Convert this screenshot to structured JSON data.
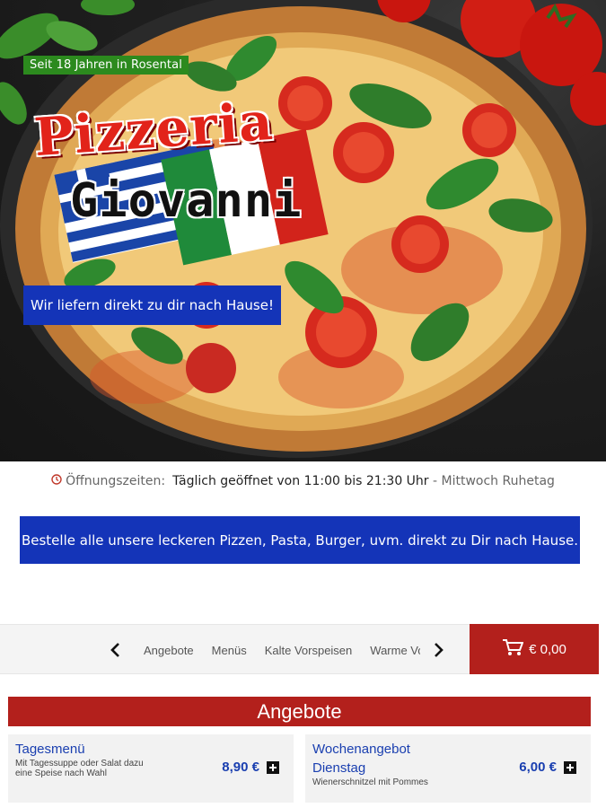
{
  "hero": {
    "since_badge": "Seit 18 Jahren in Rosental",
    "logo_line1": "Pizzeria",
    "logo_line2": "Giovanni",
    "deliver_badge": "Wir liefern direkt zu dir nach Hause!"
  },
  "hours": {
    "label": "Öffnungszeiten:",
    "times": "Täglich geöffnet von 11:00 bis 21:30 Uhr",
    "rest": " - Mittwoch Ruhetag"
  },
  "banner": "Bestelle alle unsere leckeren Pizzen, Pasta, Burger, uvm. direkt zu Dir nach Hause.",
  "categories": [
    "Angebote",
    "Menüs",
    "Kalte Vorspeisen",
    "Warme Vorspeisen"
  ],
  "cart": {
    "total": "€ 0,00"
  },
  "section_title": "Angebote",
  "products": [
    {
      "name": "Tagesmenü",
      "desc": [
        "Mit Tagessuppe oder Salat dazu",
        "eine Speise nach Wahl"
      ],
      "price": "8,90 €"
    },
    {
      "name": [
        "Wochenangebot",
        "Dienstag"
      ],
      "desc": [
        "Wienerschnitzel mit Pommes"
      ],
      "price": "6,00 €"
    }
  ],
  "colors": {
    "accent_red": "#b3201c",
    "accent_blue": "#1434b8",
    "badge_green": "#2c8a1e",
    "link_blue": "#1a3fb0"
  }
}
